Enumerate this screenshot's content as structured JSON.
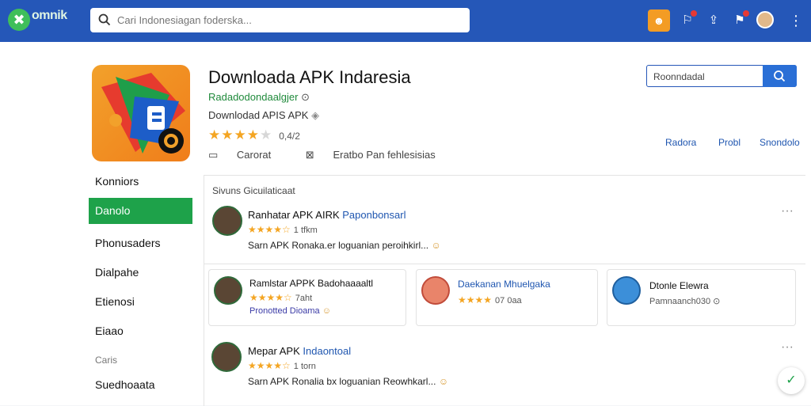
{
  "header": {
    "logo_text": "omnik",
    "logo_letter": "✖",
    "search_placeholder": "Cari Indonesiagan foderska...",
    "icons": [
      "chat-icon",
      "notification-icon",
      "share-icon",
      "alert-icon",
      "avatar",
      "more-icon"
    ]
  },
  "app": {
    "title": "Downloada APK Indaresia",
    "developer": "Radadodondaalgjer",
    "subtitle": "Downlodad APIS APK",
    "rating_stars": 4,
    "rating_text": "0,4/2",
    "meta": [
      "Carorat",
      "Eratbo Pan fehlesisias"
    ]
  },
  "search_right": {
    "value": "Roonndadal"
  },
  "links": [
    "Radora",
    "Probl",
    "Snondolo"
  ],
  "sidebar": {
    "items": [
      {
        "label": "Konniors"
      },
      {
        "label": "Danolo",
        "active": true
      },
      {
        "label": "Phonusaders"
      },
      {
        "label": "Dialpahe"
      },
      {
        "label": "Etienosi"
      },
      {
        "label": "Eiaao"
      },
      {
        "label": "Caris",
        "muted": true
      },
      {
        "label": "Suedhoaata"
      }
    ]
  },
  "reviews": {
    "section_title": "Sivuns Gicuilaticaat",
    "items": [
      {
        "name": "Ranhatar APK AIRK",
        "name_blue": "Paponbonsarl",
        "stars": "★★★★☆",
        "count": "1 tfkm",
        "text": "Sarn APK Ronaka.er loguanian peroihkirl..."
      },
      {
        "name": "Mepar APK",
        "name_blue": "Indaontoal",
        "stars": "★★★★☆",
        "count": "1 torn",
        "text": "Sarn APK Ronalia bx loguanian Reowhkarl..."
      }
    ],
    "cards": [
      {
        "name": "Ramlstar APPK Badohaaaaltl",
        "stars": "★★★★☆",
        "count": "7aht",
        "text": "Pronotted Dioama"
      },
      {
        "name": "Daekanan",
        "name_blue": "Mhuelgaka",
        "stars": "★★★★",
        "count": "07 0aa",
        "text": ""
      },
      {
        "name": "Dtonle Elewra",
        "stars": "",
        "count": "",
        "text": "Pamnaanch030"
      }
    ]
  }
}
